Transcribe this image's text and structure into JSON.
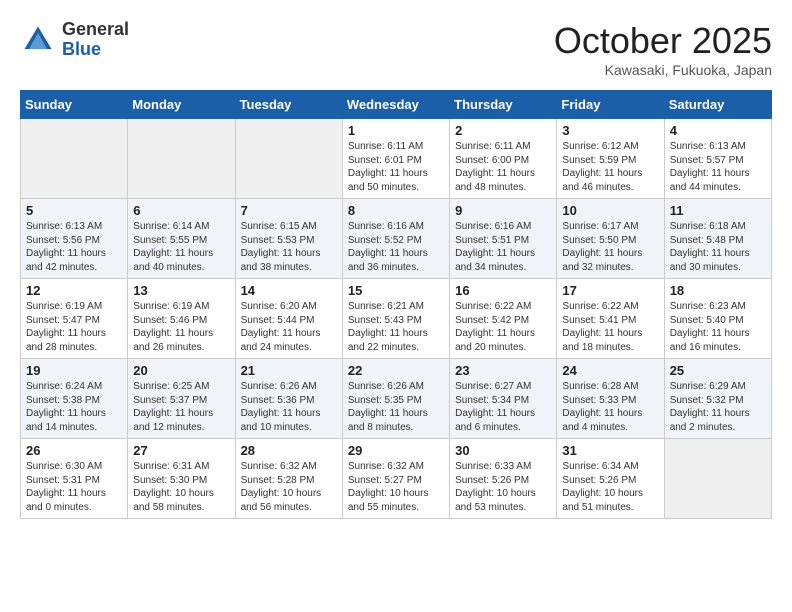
{
  "header": {
    "logo": {
      "general": "General",
      "blue": "Blue"
    },
    "title": "October 2025",
    "location": "Kawasaki, Fukuoka, Japan"
  },
  "calendar": {
    "weekdays": [
      "Sunday",
      "Monday",
      "Tuesday",
      "Wednesday",
      "Thursday",
      "Friday",
      "Saturday"
    ],
    "weeks": [
      [
        {
          "day": "",
          "info": ""
        },
        {
          "day": "",
          "info": ""
        },
        {
          "day": "",
          "info": ""
        },
        {
          "day": "1",
          "info": "Sunrise: 6:11 AM\nSunset: 6:01 PM\nDaylight: 11 hours\nand 50 minutes."
        },
        {
          "day": "2",
          "info": "Sunrise: 6:11 AM\nSunset: 6:00 PM\nDaylight: 11 hours\nand 48 minutes."
        },
        {
          "day": "3",
          "info": "Sunrise: 6:12 AM\nSunset: 5:59 PM\nDaylight: 11 hours\nand 46 minutes."
        },
        {
          "day": "4",
          "info": "Sunrise: 6:13 AM\nSunset: 5:57 PM\nDaylight: 11 hours\nand 44 minutes."
        }
      ],
      [
        {
          "day": "5",
          "info": "Sunrise: 6:13 AM\nSunset: 5:56 PM\nDaylight: 11 hours\nand 42 minutes."
        },
        {
          "day": "6",
          "info": "Sunrise: 6:14 AM\nSunset: 5:55 PM\nDaylight: 11 hours\nand 40 minutes."
        },
        {
          "day": "7",
          "info": "Sunrise: 6:15 AM\nSunset: 5:53 PM\nDaylight: 11 hours\nand 38 minutes."
        },
        {
          "day": "8",
          "info": "Sunrise: 6:16 AM\nSunset: 5:52 PM\nDaylight: 11 hours\nand 36 minutes."
        },
        {
          "day": "9",
          "info": "Sunrise: 6:16 AM\nSunset: 5:51 PM\nDaylight: 11 hours\nand 34 minutes."
        },
        {
          "day": "10",
          "info": "Sunrise: 6:17 AM\nSunset: 5:50 PM\nDaylight: 11 hours\nand 32 minutes."
        },
        {
          "day": "11",
          "info": "Sunrise: 6:18 AM\nSunset: 5:48 PM\nDaylight: 11 hours\nand 30 minutes."
        }
      ],
      [
        {
          "day": "12",
          "info": "Sunrise: 6:19 AM\nSunset: 5:47 PM\nDaylight: 11 hours\nand 28 minutes."
        },
        {
          "day": "13",
          "info": "Sunrise: 6:19 AM\nSunset: 5:46 PM\nDaylight: 11 hours\nand 26 minutes."
        },
        {
          "day": "14",
          "info": "Sunrise: 6:20 AM\nSunset: 5:44 PM\nDaylight: 11 hours\nand 24 minutes."
        },
        {
          "day": "15",
          "info": "Sunrise: 6:21 AM\nSunset: 5:43 PM\nDaylight: 11 hours\nand 22 minutes."
        },
        {
          "day": "16",
          "info": "Sunrise: 6:22 AM\nSunset: 5:42 PM\nDaylight: 11 hours\nand 20 minutes."
        },
        {
          "day": "17",
          "info": "Sunrise: 6:22 AM\nSunset: 5:41 PM\nDaylight: 11 hours\nand 18 minutes."
        },
        {
          "day": "18",
          "info": "Sunrise: 6:23 AM\nSunset: 5:40 PM\nDaylight: 11 hours\nand 16 minutes."
        }
      ],
      [
        {
          "day": "19",
          "info": "Sunrise: 6:24 AM\nSunset: 5:38 PM\nDaylight: 11 hours\nand 14 minutes."
        },
        {
          "day": "20",
          "info": "Sunrise: 6:25 AM\nSunset: 5:37 PM\nDaylight: 11 hours\nand 12 minutes."
        },
        {
          "day": "21",
          "info": "Sunrise: 6:26 AM\nSunset: 5:36 PM\nDaylight: 11 hours\nand 10 minutes."
        },
        {
          "day": "22",
          "info": "Sunrise: 6:26 AM\nSunset: 5:35 PM\nDaylight: 11 hours\nand 8 minutes."
        },
        {
          "day": "23",
          "info": "Sunrise: 6:27 AM\nSunset: 5:34 PM\nDaylight: 11 hours\nand 6 minutes."
        },
        {
          "day": "24",
          "info": "Sunrise: 6:28 AM\nSunset: 5:33 PM\nDaylight: 11 hours\nand 4 minutes."
        },
        {
          "day": "25",
          "info": "Sunrise: 6:29 AM\nSunset: 5:32 PM\nDaylight: 11 hours\nand 2 minutes."
        }
      ],
      [
        {
          "day": "26",
          "info": "Sunrise: 6:30 AM\nSunset: 5:31 PM\nDaylight: 11 hours\nand 0 minutes."
        },
        {
          "day": "27",
          "info": "Sunrise: 6:31 AM\nSunset: 5:30 PM\nDaylight: 10 hours\nand 58 minutes."
        },
        {
          "day": "28",
          "info": "Sunrise: 6:32 AM\nSunset: 5:28 PM\nDaylight: 10 hours\nand 56 minutes."
        },
        {
          "day": "29",
          "info": "Sunrise: 6:32 AM\nSunset: 5:27 PM\nDaylight: 10 hours\nand 55 minutes."
        },
        {
          "day": "30",
          "info": "Sunrise: 6:33 AM\nSunset: 5:26 PM\nDaylight: 10 hours\nand 53 minutes."
        },
        {
          "day": "31",
          "info": "Sunrise: 6:34 AM\nSunset: 5:26 PM\nDaylight: 10 hours\nand 51 minutes."
        },
        {
          "day": "",
          "info": ""
        }
      ]
    ]
  }
}
